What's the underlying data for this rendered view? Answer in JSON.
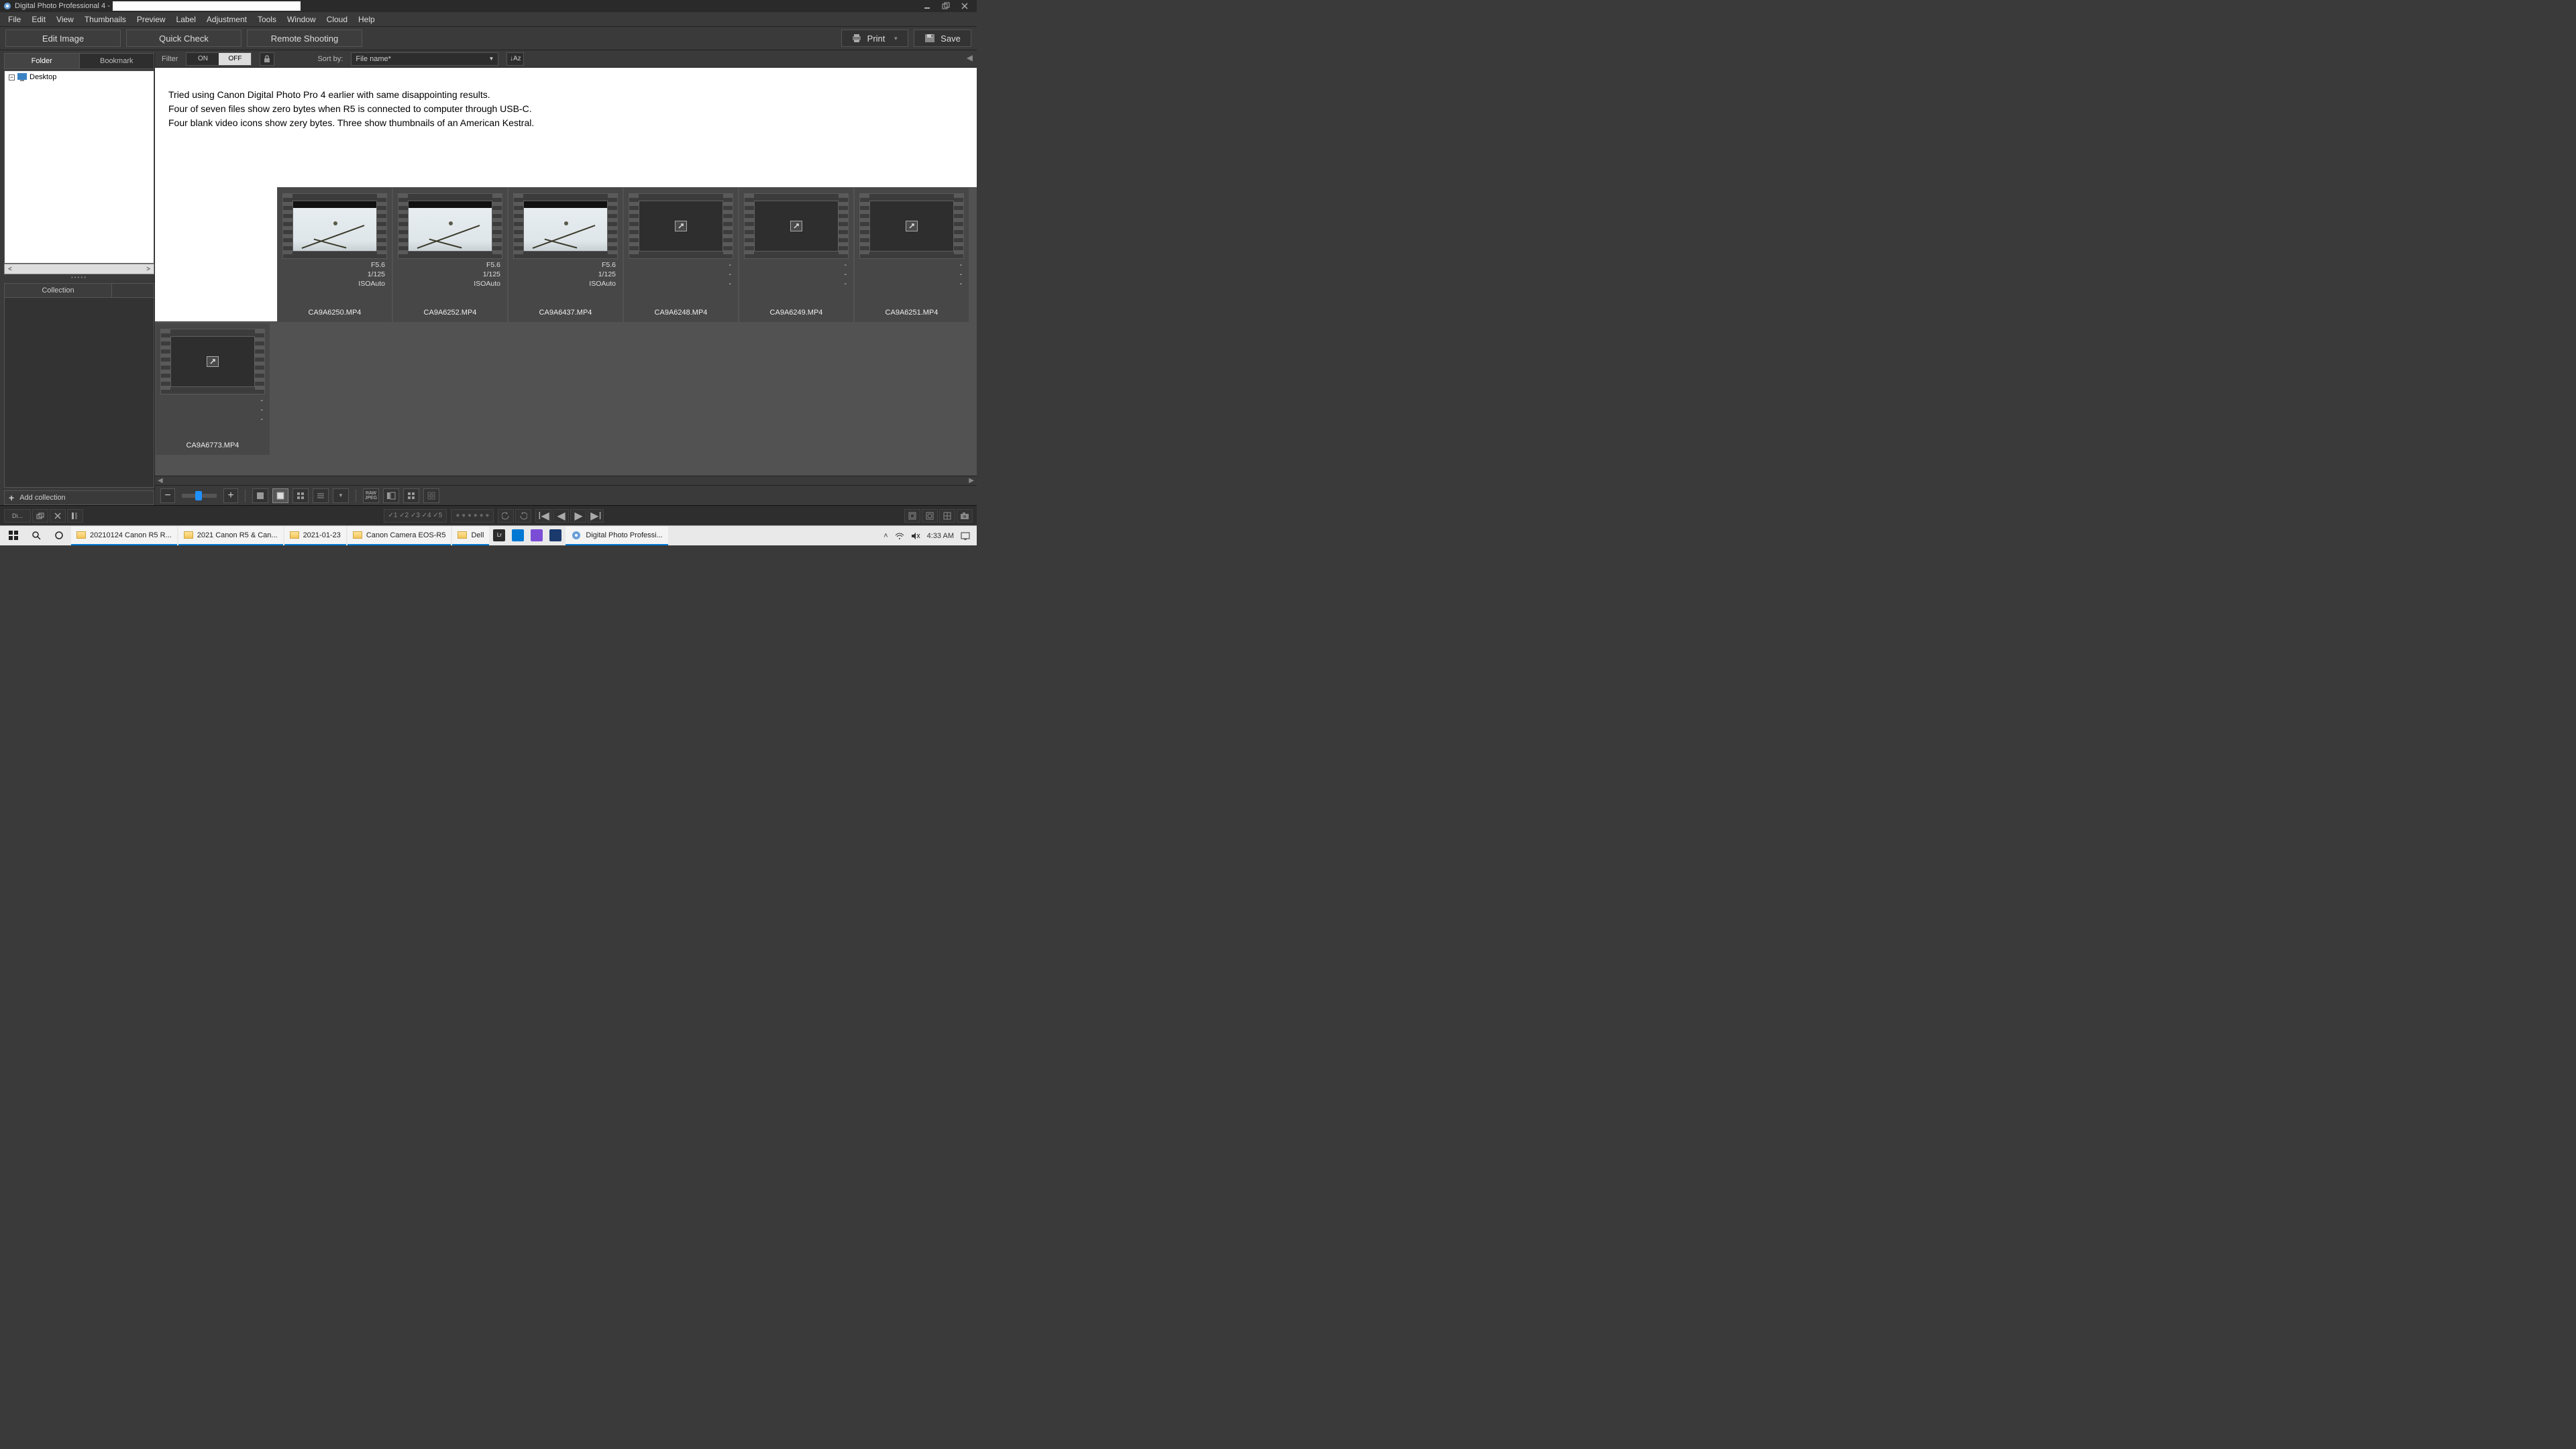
{
  "titlebar": {
    "app_name": "Digital Photo Professional 4 -"
  },
  "menu": [
    "File",
    "Edit",
    "View",
    "Thumbnails",
    "Preview",
    "Label",
    "Adjustment",
    "Tools",
    "Window",
    "Cloud",
    "Help"
  ],
  "toolbar": {
    "edit_image": "Edit Image",
    "quick_check": "Quick Check",
    "remote_shooting": "Remote Shooting",
    "print": "Print",
    "save": "Save"
  },
  "left": {
    "tab_folder": "Folder",
    "tab_bookmark": "Bookmark",
    "tree": {
      "root": "Desktop"
    },
    "collection_tab": "Collection",
    "add_collection": "Add collection"
  },
  "filterbar": {
    "filter_label": "Filter",
    "on": "ON",
    "off": "OFF",
    "sort_label": "Sort by:",
    "sort_value": "File name*",
    "sort_order_icon": "↓Aᴢ"
  },
  "note": {
    "line1": "Tried using Canon Digital Photo Pro 4 earlier with same disappointing results.",
    "line2": "Four of seven files show zero bytes when R5 is connected to computer through USB-C.",
    "line3": "Four blank video icons show zery bytes.  Three show thumbnails of an American Kestral."
  },
  "thumbs": [
    {
      "filename": "CA9A6250.MP4",
      "aperture": "F5.6",
      "shutter": "1/125",
      "iso": "ISOAuto",
      "has_image": true
    },
    {
      "filename": "CA9A6252.MP4",
      "aperture": "F5.6",
      "shutter": "1/125",
      "iso": "ISOAuto",
      "has_image": true
    },
    {
      "filename": "CA9A6437.MP4",
      "aperture": "F5.6",
      "shutter": "1/125",
      "iso": "ISOAuto",
      "has_image": true
    },
    {
      "filename": "CA9A6248.MP4",
      "aperture": "-",
      "shutter": "-",
      "iso": "-",
      "has_image": false
    },
    {
      "filename": "CA9A6249.MP4",
      "aperture": "-",
      "shutter": "-",
      "iso": "-",
      "has_image": false
    },
    {
      "filename": "CA9A6251.MP4",
      "aperture": "-",
      "shutter": "-",
      "iso": "-",
      "has_image": false
    },
    {
      "filename": "CA9A6773.MP4",
      "aperture": "-",
      "shutter": "-",
      "iso": "-",
      "has_image": false
    }
  ],
  "status": {
    "checkmarks": "✓1 ✓2 ✓3 ✓4 ✓5"
  },
  "taskbar": {
    "items": [
      {
        "label": "20210124 Canon R5 R...",
        "icon": "folder"
      },
      {
        "label": "2021 Canon R5 & Can...",
        "icon": "folder"
      },
      {
        "label": "2021-01-23",
        "icon": "folder"
      },
      {
        "label": "Canon Camera EOS-R5",
        "icon": "folder"
      },
      {
        "label": "Dell",
        "icon": "folder"
      },
      {
        "label": "Digital Photo Professi...",
        "icon": "app"
      }
    ],
    "time": "4:33 AM"
  }
}
